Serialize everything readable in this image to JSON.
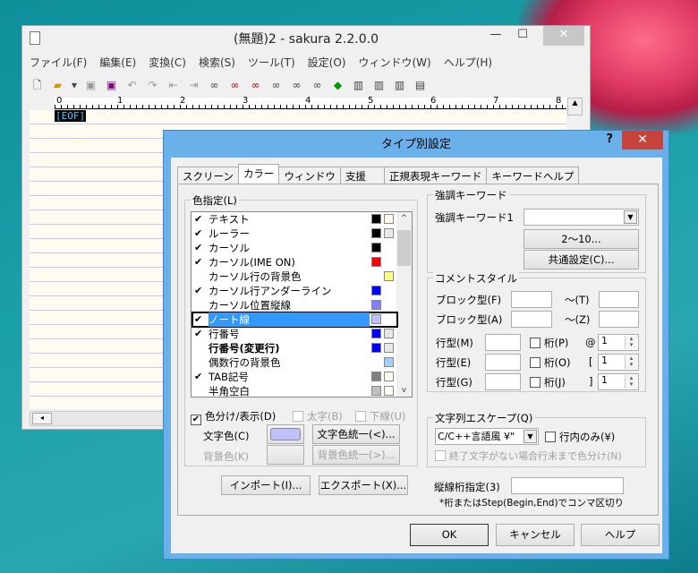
{
  "editor": {
    "title": "(無題)2 - sakura 2.2.0.0",
    "minimize": "—",
    "maximize": "☐",
    "close": "✕",
    "menu": [
      "ファイル(F)",
      "編集(E)",
      "変換(C)",
      "検索(S)",
      "ツール(T)",
      "設定(O)",
      "ウィンドウ(W)",
      "ヘルプ(H)"
    ],
    "ruler": [
      "0",
      "1",
      "2",
      "3",
      "4",
      "5",
      "6",
      "7",
      "8"
    ],
    "eof": "[EOF]"
  },
  "dialog": {
    "title": "タイプ別設定",
    "help_q": "?",
    "close": "✕",
    "tabs": [
      "スクリーン",
      "カラー",
      "ウィンドウ",
      "支援",
      "正規表現キーワード",
      "キーワードヘルプ"
    ],
    "color_group": "色指定(L)",
    "items": [
      {
        "label": "テキスト",
        "checked": true,
        "fg": "#000000",
        "bg": "#fffbf0"
      },
      {
        "label": "ルーラー",
        "checked": true,
        "fg": "#000000",
        "bg": "#e8e8e8"
      },
      {
        "label": "カーソル",
        "checked": true,
        "fg": "#000000",
        "bg": null
      },
      {
        "label": "カーソル(IME ON)",
        "checked": true,
        "fg": "#ff0000",
        "bg": null
      },
      {
        "label": "カーソル行の背景色",
        "checked": false,
        "fg": null,
        "bg": "#ffff80"
      },
      {
        "label": "カーソル行アンダーライン",
        "checked": true,
        "fg": "#0000ff",
        "bg": null
      },
      {
        "label": "カーソル位置縦線",
        "checked": false,
        "fg": "#8080ff",
        "bg": null
      },
      {
        "label": "ノート線",
        "checked": true,
        "fg": "#c0c0ff",
        "bg": null,
        "selected": true
      },
      {
        "label": "行番号",
        "checked": true,
        "fg": "#0000ff",
        "bg": "#e8e8e8"
      },
      {
        "label": "行番号(変更行)",
        "checked": false,
        "fg": "#0000ff",
        "bg": "#e8e8e8",
        "bold": true
      },
      {
        "label": "偶数行の背景色",
        "checked": false,
        "fg": null,
        "bg": "#a0d0ff"
      },
      {
        "label": "TAB記号",
        "checked": true,
        "fg": "#808080",
        "bg": "#fffbf0"
      },
      {
        "label": "半角空白",
        "checked": false,
        "fg": "#c0c0c0",
        "bg": "#fffbf0"
      }
    ],
    "color_display": "色分け/表示(D)",
    "bold": "太字(B)",
    "underline": "下線(U)",
    "text_color": "文字色(C)",
    "text_color_value": "#c0c0ff",
    "unify_text": "文字色統一(<)...",
    "bg_color": "背景色(K)",
    "unify_bg": "背景色統一(>)...",
    "import": "インポート(I)...",
    "export": "エクスポート(X)...",
    "kw_group": "強調キーワード",
    "kw1": "強調キーワード1",
    "kw_2_10": "2〜10...",
    "kw_common": "共通設定(C)...",
    "comment_group": "コメントスタイル",
    "block_f": "ブロック型(F)",
    "tilde_t": "〜(T)",
    "block_a": "ブロック型(A)",
    "tilde_z": "〜(Z)",
    "line_m": "行型(M)",
    "line_e": "行型(E)",
    "line_g": "行型(G)",
    "col_p": "桁(P)",
    "col_o": "桁(O)",
    "col_j": "桁(J)",
    "at": "@",
    "lb": "[",
    "rb": "]",
    "spin_m": "1",
    "spin_e": "1",
    "spin_g": "1",
    "esc_group": "文字列エスケープ(Q)",
    "esc_value": "C/C++言語風 ¥\"",
    "inline_only": "行内のみ(¥)",
    "to_eol": "終了文字がない場合行末まで色分け(N)",
    "vline_label": "縦線桁指定(3)",
    "vline_note": "*桁またはStep(Begin,End)でコンマ区切り",
    "ok": "OK",
    "cancel": "キャンセル",
    "help": "ヘルプ"
  }
}
